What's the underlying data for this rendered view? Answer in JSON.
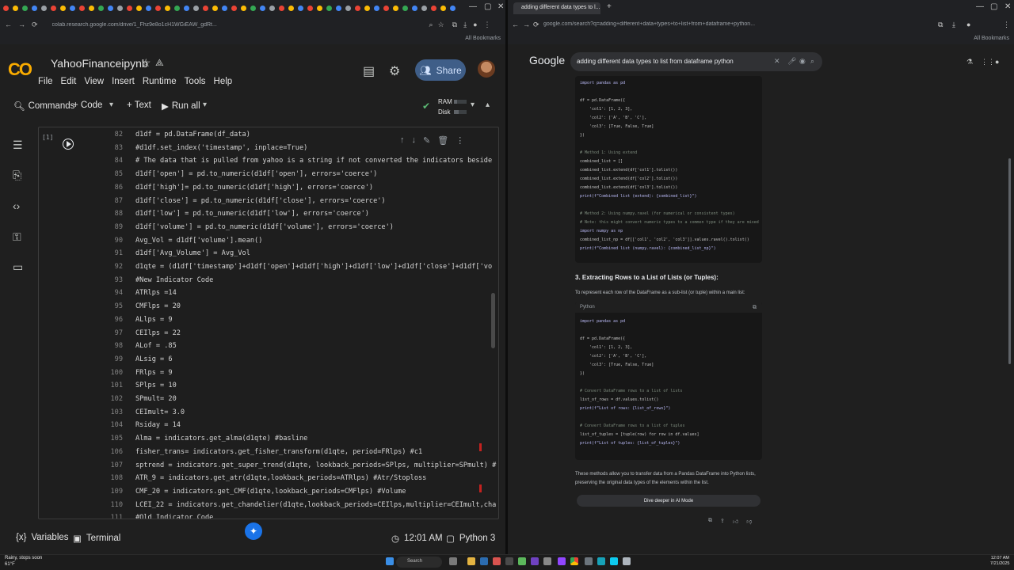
{
  "colab": {
    "notebook_name": "YahooFinanceipynb",
    "address": "colab.research.google.com/drive/1_Fhz9e8o1cH1WGiEAW_gdRt...",
    "bookmarks_label": "All Bookmarks",
    "menu": [
      "File",
      "Edit",
      "View",
      "Insert",
      "Runtime",
      "Tools",
      "Help"
    ],
    "share_label": "Share",
    "toolbar": {
      "commands": "Commands",
      "code": "+ Code",
      "text": "+ Text",
      "run_all": "Run all",
      "ram": "RAM",
      "disk": "Disk"
    },
    "cell": {
      "exec_count": "[1]",
      "lines": [
        {
          "n": "82",
          "t": "d1df = pd.DataFrame(df_data)"
        },
        {
          "n": "83",
          "t": "#d1df.set_index('timestamp', inplace=True)"
        },
        {
          "n": "84",
          "t": "# The data that is pulled from yahoo is a string if not converted the indicators beside"
        },
        {
          "n": "85",
          "t": "d1df['open'] = pd.to_numeric(d1df['open'], errors='coerce')"
        },
        {
          "n": "86",
          "t": "d1df['high']= pd.to_numeric(d1df['high'], errors='coerce')"
        },
        {
          "n": "87",
          "t": "d1df['close'] = pd.to_numeric(d1df['close'], errors='coerce')"
        },
        {
          "n": "88",
          "t": "d1df['low'] = pd.to_numeric(d1df['low'], errors='coerce')"
        },
        {
          "n": "89",
          "t": "d1df['volume'] = pd.to_numeric(d1df['volume'], errors='coerce')"
        },
        {
          "n": "90",
          "t": "Avg_Vol = d1df['volume'].mean()"
        },
        {
          "n": "91",
          "t": "d1df['Avg_Volume'] = Avg_Vol"
        },
        {
          "n": "92",
          "t": "d1qte = (d1df['timestamp']+d1df['open']+d1df['high']+d1df['low']+d1df['close']+d1df['vo"
        },
        {
          "n": "93",
          "t": "#New Indicator Code"
        },
        {
          "n": "94",
          "t": "ATRlps =14"
        },
        {
          "n": "95",
          "t": "CMFlps = 20"
        },
        {
          "n": "96",
          "t": "ALlps = 9"
        },
        {
          "n": "97",
          "t": "CEIlps = 22"
        },
        {
          "n": "98",
          "t": "ALof = .85"
        },
        {
          "n": "99",
          "t": "ALsig = 6"
        },
        {
          "n": "100",
          "t": "FRlps = 9"
        },
        {
          "n": "101",
          "t": "SPlps = 10"
        },
        {
          "n": "102",
          "t": "SPmult= 20"
        },
        {
          "n": "103",
          "t": "CEImult= 3.0"
        },
        {
          "n": "104",
          "t": "Rsiday = 14"
        },
        {
          "n": "105",
          "t": "Alma = indicators.get_alma(d1qte) #basline"
        },
        {
          "n": "106",
          "t": "fisher_trans= indicators.get_fisher_transform(d1qte, period=FRlps) #c1"
        },
        {
          "n": "107",
          "t": "sptrend = indicators.get_super_trend(d1qte, lookback_periods=SPlps, multiplier=SPmult) #"
        },
        {
          "n": "108",
          "t": "ATR_9 = indicators.get_atr(d1qte,lookback_periods=ATRlps) #Atr/Stoploss"
        },
        {
          "n": "109",
          "t": "CMF_20 = indicators.get_CMF(d1qte,lookback_periods=CMFlps) #Volume"
        },
        {
          "n": "110",
          "t": "LCEI_22 = indicators.get_chandelier(d1qte,lookback_periods=CEIlps,multiplier=CEImult,cha"
        },
        {
          "n": "111",
          "t": "#Old Indicator Code"
        }
      ]
    },
    "status": {
      "variables": "Variables",
      "terminal": "Terminal",
      "time": "12:01 AM",
      "runtime": "Python 3"
    }
  },
  "google": {
    "tab_title": "adding different data types to l...",
    "address": "google.com/search?q=adding+different+data+types+to+list+from+dataframe+python...",
    "bookmarks_label": "All Bookmarks",
    "logo": "Google",
    "query": "adding different data types to list from dataframe python",
    "code1": [
      "import pandas as pd",
      "",
      "df = pd.DataFrame({",
      "    'col1': [1, 2, 3],",
      "    'col2': ['A', 'B', 'C'],",
      "    'col3': [True, False, True]",
      "})",
      "",
      "# Method 1: Using extend",
      "combined_list = []",
      "combined_list.extend(df['col1'].tolist())",
      "combined_list.extend(df['col2'].tolist())",
      "combined_list.extend(df['col3'].tolist())",
      "print(f\"Combined list (extend): {combined_list}\")",
      "",
      "# Method 2: Using numpy.ravel (for numerical or consistent types)",
      "# Note: this might convert numeric types to a common type if they are mixed",
      "import numpy as np",
      "combined_list_np = df[['col1', 'col2', 'col3']].values.ravel().tolist()",
      "print(f\"Combined list (numpy.ravel): {combined_list_np}\")"
    ],
    "heading3": "3. Extracting Rows to a List of Lists (or Tuples):",
    "intro3": "To represent each row of the DataFrame as a sub-list (or tuple) within a main list:",
    "code2_lang": "Python",
    "code2": [
      "import pandas as pd",
      "",
      "df = pd.DataFrame({",
      "    'col1': [1, 2, 3],",
      "    'col2': ['A', 'B', 'C'],",
      "    'col3': [True, False, True]",
      "})",
      "",
      "# Convert DataFrame rows to a list of lists",
      "list_of_rows = df.values.tolist()",
      "print(f\"List of rows: {list_of_rows}\")",
      "",
      "# Convert DataFrame rows to a list of tuples",
      "list_of_tuples = [tuple(row) for row in df.values]",
      "print(f\"List of tuples: {list_of_tuples}\")"
    ],
    "summary": "These methods allow you to transfer data from a Pandas DataFrame into Python lists, preserving the original data types of the elements within the list.",
    "dive_deeper": "Dive deeper in AI Mode"
  },
  "taskbar": {
    "weather_line1": "Rainy, stops soon",
    "weather_line2": "61°F",
    "search": "Search",
    "clock_time": "12:07 AM",
    "clock_date": "7/21/2025"
  }
}
